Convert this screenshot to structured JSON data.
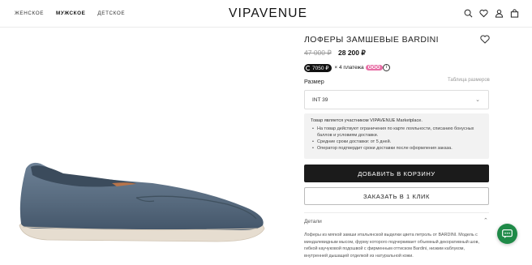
{
  "header": {
    "nav": [
      "ЖЕНСКОЕ",
      "МУЖСКОЕ",
      "ДЕТСКОЕ"
    ],
    "logo": "VIPAVENUE",
    "icons": [
      "search-icon",
      "heart-icon",
      "user-icon",
      "bag-icon"
    ]
  },
  "product": {
    "title": "ЛОФЕРЫ ЗАМШЕВЫЕ BARDINI",
    "old_price": "47 000 ₽",
    "new_price": "28 200 ₽",
    "installment_amount": "7050 ₽",
    "installment_count": "× 4 платежа",
    "installment_brand": "OOO"
  },
  "size": {
    "label": "Размер",
    "table_link": "Таблица размеров",
    "selected": "INT 39"
  },
  "notice": {
    "head": "Товар является участником VIPAVENUE Marketplace.",
    "items": [
      "На товар действуют ограничения по карте лояльности, списанию бонусных баллов и условиям доставки.",
      "Средние сроки доставки: от 5 дней.",
      "Оператор подтвердит сроки доставки после оформления заказа."
    ]
  },
  "buttons": {
    "add_to_cart": "ДОБАВИТЬ В КОРЗИНУ",
    "one_click": "ЗАКАЗАТЬ В 1 КЛИК"
  },
  "details": {
    "label": "Детали",
    "text": "Лоферы из мягкой замши итальянской выделки цвета петроль от BARDINI. Модель с миндалевидным мысом, фурму которого подчеркивает объемный декоративный шов, гибкой каучуковой подошвой с фирменным оттиском Bardini, низким каблуком, внутренней дышащей отделкой из натуральной кожи."
  },
  "colors": {
    "accent": "#1b1b1b",
    "pink": "#e86fa6",
    "chat": "#1f8a48",
    "shoe": "#5c7187"
  }
}
